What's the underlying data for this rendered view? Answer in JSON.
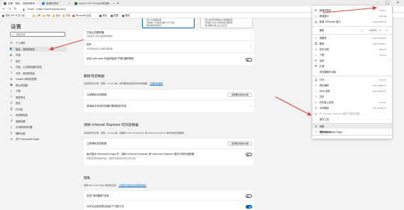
{
  "tabs": [
    {
      "label": "设置 - 隐私、搜索和服务"
    },
    {
      "label": "新建标签页"
    },
    {
      "label": "win10 OFF-6 Edge浏览器..."
    }
  ],
  "address": {
    "prefix": "Edge",
    "sep": " | ",
    "url": "edge://settings/privacy"
  },
  "favorites": [
    {
      "label": "重庆 OFF-6 白小龙"
    },
    {
      "label": "上海"
    },
    {
      "label": "平台"
    },
    {
      "label": "后台"
    },
    {
      "label": "平台"
    },
    {
      "label": "Microsoft 必应"
    },
    {
      "label": "新区"
    },
    {
      "label": "图表"
    },
    {
      "label": "翻译"
    }
  ],
  "sidebar": {
    "title": "设置",
    "search_placeholder": "搜索设置",
    "items": [
      {
        "label": "个人资料",
        "icon": "person-icon"
      },
      {
        "label": "隐私、搜索和服务",
        "icon": "lock-icon"
      },
      {
        "label": "外观",
        "icon": "appearance-icon"
      },
      {
        "label": "侧栏",
        "icon": "sidebar-icon"
      },
      {
        "label": "开始、主页和新建标签页",
        "icon": "home-icon"
      },
      {
        "label": "共享、复制和粘贴",
        "icon": "share-icon"
      },
      {
        "label": "Cookie 和网站权限",
        "icon": "cookie-icon"
      },
      {
        "label": "默认浏览器",
        "icon": "browser-icon"
      },
      {
        "label": "下载",
        "icon": "download-icon"
      },
      {
        "label": "家庭安全",
        "icon": "family-icon"
      },
      {
        "label": "语言",
        "icon": "language-icon"
      },
      {
        "label": "打印机",
        "icon": "printer-icon"
      },
      {
        "label": "系统和性能",
        "icon": "system-icon"
      },
      {
        "label": "重置设置",
        "icon": "reset-icon"
      },
      {
        "label": "手机和其他设备",
        "icon": "phone-icon"
      },
      {
        "label": "辅助功能",
        "icon": "accessibility-icon"
      },
      {
        "label": "关于 Microsoft Edge",
        "icon": "edge-icon"
      }
    ]
  },
  "tracking_cards": [
    {
      "lines": [
        "· 阻止大多数跟踪器",
        "· 内容和广告可能包含极少的个性化",
        "· 网站将按预期运行"
      ]
    },
    {
      "lines": [
        "· 阻止来自所有网站的大多数跟踪器",
        "· 内容和广告的个性化程度可能降低",
        "· 部分网站可能无法正常工作"
      ]
    }
  ],
  "tracking_rows": [
    {
      "title": "已阻止的跟踪器",
      "sub": "查看我们已阻止跟踪你的网站"
    },
    {
      "title": "例外",
      "sub": "允许所选站点上的所有跟踪器"
    },
    {
      "title": "浏览 InPrivate 时始终使用\"严格\"跟踪预防"
    }
  ],
  "clear_section": {
    "heading": "删除浏览数据",
    "desc": "这包括历史记录、密码、Cookie 等。将仅删除此配置文件中的数据。",
    "link": "管理你的数据",
    "row1": "立即删除浏览数据",
    "row1_button": "选择要清除的内容",
    "row2": "选择每次关闭浏览器时要清除的内容"
  },
  "ie_section": {
    "heading": "清除 Internet Explorer 的浏览数据",
    "desc": "这包括历史记录、密码、Cookie 等。将删除 Internet Explorer 和 Internet Explorer 模式中的所选数据。",
    "row1": "立即清除浏览数据",
    "row1_button": "选择要清除的内容",
    "row2": "每次退出 Microsoft Edge 时，清除 Internet Explorer 和 Internet Explorer 模式中的所选数据",
    "row2_sub": "若要选择要清除的内容，请转到 删除浏览历史记录 菜单"
  },
  "privacy_section": {
    "heading": "隐私",
    "desc": "选择 Microsoft Edge 的隐私设置。",
    "link": "了解有关这些设置的更多信息",
    "row1": "发送\"请勿跟踪\"请求",
    "row2": "允许站点检查是否保存了付款方式"
  },
  "menu": {
    "items": [
      {
        "label": "新建标签页",
        "shortcut": "Ctrl+T",
        "icon": "new-tab-icon"
      },
      {
        "label": "新建窗口",
        "shortcut": "Ctrl+N",
        "icon": "new-window-icon"
      },
      {
        "label": "新建 InPrivate 窗口",
        "shortcut": "Ctrl+Shift+N",
        "icon": "inprivate-icon"
      },
      {
        "label": "缩放",
        "zoom": "100%",
        "icon": "zoom-icon"
      },
      {
        "label": "收藏夹",
        "shortcut": "Ctrl+Shift+O",
        "icon": "favorites-icon"
      },
      {
        "label": "集锦",
        "shortcut": "Ctrl+Shift+Y",
        "icon": "collections-icon"
      },
      {
        "label": "历史记录",
        "shortcut": "Ctrl+H",
        "icon": "history-icon"
      },
      {
        "label": "下载",
        "shortcut": "Ctrl+J",
        "icon": "download-icon"
      },
      {
        "label": "应用",
        "icon": "apps-icon",
        "arrow": true
      },
      {
        "label": "扩展",
        "icon": "extensions-icon"
      },
      {
        "label": "浏览器基本功能",
        "icon": "heart-icon"
      },
      {
        "label": "打印",
        "shortcut": "Ctrl+P",
        "icon": "print-icon"
      },
      {
        "label": "网页捕获",
        "shortcut": "Ctrl+Shift+S",
        "icon": "capture-icon"
      },
      {
        "label": "Web 选择",
        "shortcut": "Ctrl+Shift+X",
        "icon": "web-select-icon"
      },
      {
        "label": "共享",
        "icon": "share-icon"
      },
      {
        "label": "在页面上查找",
        "shortcut": "Ctrl+F",
        "icon": "find-icon"
      },
      {
        "label": "大声朗读",
        "shortcut": "Ctrl+Shift+U",
        "icon": "read-aloud-icon"
      },
      {
        "label": "在 Internet Explorer 模式下重新加载",
        "icon": "ie-icon",
        "disabled": true
      },
      {
        "label": "更多工具",
        "icon": "more-tools-icon",
        "arrow": true
      },
      {
        "label": "设置",
        "icon": "gear-icon"
      },
      {
        "label": "帮助和反馈",
        "icon": "help-icon",
        "arrow": true
      },
      {
        "label": "关闭 Microsoft Edge",
        "icon": "close-edge-icon"
      }
    ],
    "zoom_minus": "—",
    "zoom_plus": "+",
    "zoom_full": "⤢"
  },
  "colors": {
    "accent": "#0067c0",
    "arrow": "#e0443a"
  }
}
